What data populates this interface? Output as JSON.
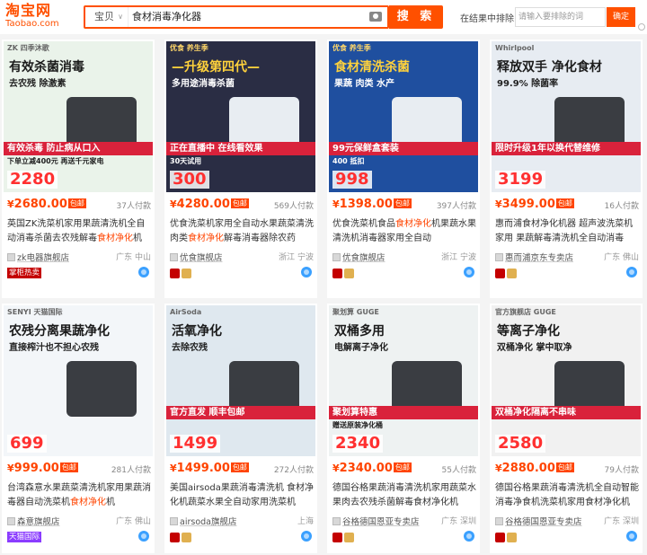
{
  "header": {
    "logo_cn": "淘宝网",
    "logo_en": "Taobao.com",
    "search_category": "宝贝",
    "search_query": "食材消毒净化器",
    "search_button": "搜 索",
    "within_label": "在结果中排除",
    "within_placeholder": "请输入要排除的词",
    "within_button": "确定"
  },
  "products": [
    {
      "price": "2680.00",
      "buyers": "37人付款",
      "title_a": "英国ZK洗菜机家用果蔬清洗机全自动消毒杀菌去农残解毒",
      "title_hl": "食材净化",
      "title_b": "机",
      "shop": "zk电器旗舰店",
      "loc": "广东 中山",
      "badge": "掌柜热卖",
      "img": {
        "brand": "ZK 四季沐歌",
        "head": "有效杀菌消毒",
        "head2": "去农残 除激素",
        "band": "有效杀毒 防止病从口入",
        "sub": "下单立减400元 再送千元家电",
        "bigp": "2280",
        "bg": "#eaf3ea"
      }
    },
    {
      "price": "4280.00",
      "buyers": "569人付款",
      "title_a": "优食洗菜机家用全自动水果蔬菜清洗肉类",
      "title_hl": "食材净化",
      "title_b": "解毒消毒器除农药",
      "title_hl2": "",
      "shop": "优食旗舰店",
      "loc": "浙江 宁波",
      "badge": "",
      "img": {
        "brand": "优食 养生季",
        "head": "—升级第四代—",
        "head2": "多用途消毒杀菌",
        "band": "正在直播中 在线看效果",
        "sub": "30天试用",
        "bigp": "300",
        "bg": "#2a2d44"
      }
    },
    {
      "price": "1398.00",
      "buyers": "397人付款",
      "title_a": "优食洗菜机食品",
      "title_hl": "食材净化",
      "title_b": "机果蔬水果清洗机消毒器家用全自动",
      "shop": "优食旗舰店",
      "loc": "浙江 宁波",
      "badge": "",
      "img": {
        "brand": "优食 养生季",
        "head": "食材清洗杀菌",
        "head2": "果蔬 肉类 水产",
        "band": "99元保鲜盒套装",
        "sub": "400 抵扣",
        "bigp": "998",
        "bg": "#1f4f9f"
      }
    },
    {
      "price": "3499.00",
      "buyers": "16人付款",
      "title_a": "惠而浦食材净化机器 超声波洗菜机家用 果蔬解毒清洗机全自动消毒",
      "title_hl": "",
      "title_b": "",
      "shop": "惠而浦京东专卖店",
      "loc": "广东 佛山",
      "badge": "",
      "img": {
        "brand": "Whirlpool",
        "head": "释放双手 净化食材",
        "head2": "99.9% 除菌率",
        "band": "限时升级1年以换代替维修",
        "sub": "",
        "bigp": "3199",
        "bg": "#e7ecf2"
      }
    },
    {
      "price": "999.00",
      "buyers": "281人付款",
      "title_a": "台湾森意水果蔬菜清洗机家用果蔬消毒器自动洗菜机",
      "title_hl": "食材净化",
      "title_b": "机",
      "shop": "森意旗舰店",
      "loc": "广东 佛山",
      "badge": "天猫国际",
      "img": {
        "brand": "SENYI 天猫国际",
        "head": "农残分离果蔬净化",
        "head2": "直接榨汁也不担心农残",
        "band": "",
        "sub": "",
        "bigp": "699",
        "bg": "#f3f6f9"
      }
    },
    {
      "price": "1499.00",
      "buyers": "272人付款",
      "title_a": "美国airsoda果蔬消毒清洗机 食材净化机蔬菜水果全自动家用洗菜机",
      "title_hl": "",
      "title_b": "",
      "shop": "airsoda旗舰店",
      "loc": "上海",
      "badge": "",
      "img": {
        "brand": "AirSoda",
        "head": "活氧净化",
        "head2": "去除农残",
        "band": "官方直发 顺丰包邮",
        "sub": "",
        "bigp": "1499",
        "bg": "#dfe8ef"
      }
    },
    {
      "price": "2340.00",
      "buyers": "55人付款",
      "title_a": "德国谷格果蔬消毒清洗机家用蔬菜水果肉去农残杀菌解毒食材净化机",
      "title_hl": "",
      "title_b": "",
      "shop": "谷格德国恩亚专卖店",
      "loc": "广东 深圳",
      "badge": "",
      "img": {
        "brand": "聚划算 GUGE",
        "head": "双桶多用",
        "head2": "电解离子净化",
        "band": "聚划算特惠",
        "sub": "赠送原装净化桶",
        "bigp": "2340",
        "bg": "#eef2f2"
      }
    },
    {
      "price": "2880.00",
      "buyers": "79人付款",
      "title_a": "德国谷格果蔬消毒清洗机全自动智能消毒净食机洗菜机家用食材净化机",
      "title_hl": "",
      "title_b": "",
      "shop": "谷格德国恩亚专卖店",
      "loc": "广东 深圳",
      "badge": "",
      "img": {
        "brand": "官方旗舰店 GUGE",
        "head": "等离子净化",
        "head2": "双桶净化 掌中取净",
        "band": "双桶净化隔离不串味",
        "sub": "",
        "bigp": "2580",
        "bg": "#f1f1f1"
      }
    }
  ],
  "colors": {
    "accent": "#ff5000",
    "price": "#ff4400",
    "tmall_red": "#c40000"
  },
  "icons": [
    "camera-icon",
    "wangwang-icon",
    "tmall-icon",
    "gold-seller-icon"
  ]
}
